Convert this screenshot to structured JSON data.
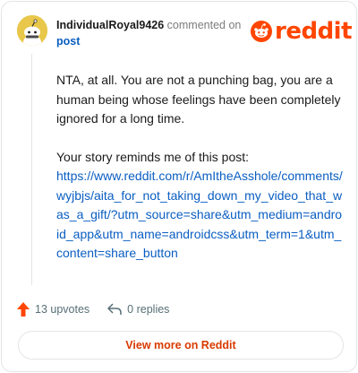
{
  "comment": {
    "username": "IndividualRoyal9426",
    "action_text": "commented on",
    "post_link": "post",
    "body_paragraph_1": "NTA, at all. You are not a punching bag, you are a human being whose feelings have been completely ignored for a long time.",
    "body_paragraph_2_prefix": "Your story reminds me of this post:",
    "body_link": "https://www.reddit.com/r/AmItheAsshole/comments/wyjbjs/aita_for_not_taking_down_my_video_that_was_a_gift/?utm_source=share&utm_medium=android_app&utm_name=androidcss&utm_term=1&utm_content=share_button"
  },
  "brand": {
    "logo_text": "reddit",
    "accent_color": "#ff4500",
    "link_color": "#0a5ec2"
  },
  "actions": {
    "upvotes_label": "13 upvotes",
    "replies_label": "0 replies",
    "view_more_label": "View more on Reddit"
  },
  "icons": {
    "avatar": "snoo-avatar-icon",
    "logo": "reddit-snoo-logo-icon",
    "upvote": "upvote-arrow-icon",
    "reply": "reply-arrow-icon"
  }
}
